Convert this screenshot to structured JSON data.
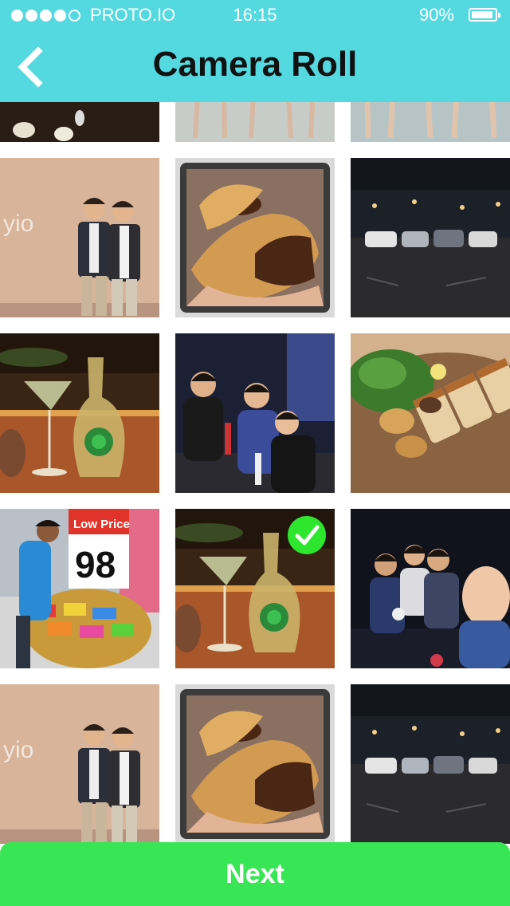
{
  "status_bar": {
    "carrier": "PROTO.IO",
    "time": "16:15",
    "battery": "90%",
    "signal_bars_filled": 4,
    "signal_bars_total": 5,
    "battery_level": 0.9
  },
  "header": {
    "title": "Camera Roll",
    "back_icon": "chevron-left-icon",
    "background_color": "#55d9e0"
  },
  "photos": [
    {
      "subject": "partial row of photos"
    },
    {
      "subject": "partial row of photos"
    },
    {
      "subject": "partial row of photos"
    },
    {
      "subject": "two men posing in front of banner"
    },
    {
      "subject": "hand holding filled doughnut"
    },
    {
      "subject": "cars in parking lot at night"
    },
    {
      "subject": "cocktail glass and carafe on bar"
    },
    {
      "subject": "group of friends on sofa"
    },
    {
      "subject": "plate of pork and potatoes"
    },
    {
      "subject": "man at candy bin with price sign"
    },
    {
      "subject": "cocktail glass and carafe on bar",
      "selected": true
    },
    {
      "subject": "group of friends at party"
    },
    {
      "subject": "two men posing in front of banner"
    },
    {
      "subject": "hand holding filled doughnut"
    },
    {
      "subject": "cars in parking lot at night"
    }
  ],
  "photo_texts": {
    "price_sign": "Low Price",
    "price_value": "98",
    "banner_logo": "yio"
  },
  "footer": {
    "next_label": "Next",
    "button_color": "#38e655"
  }
}
